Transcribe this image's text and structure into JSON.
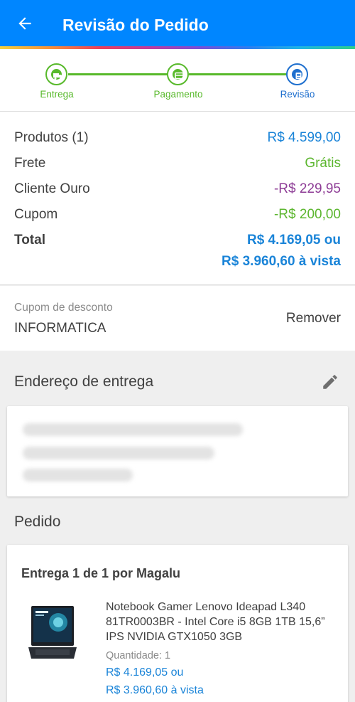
{
  "colors": {
    "header": "#0086ff",
    "accent_blue": "#1a84d8",
    "success_green": "#5cb62f",
    "discount_purple": "#8e3d96"
  },
  "header": {
    "title": "Revisão do Pedido",
    "back_icon": "arrow-left-icon"
  },
  "stepper": {
    "steps": [
      {
        "label": "Entrega",
        "icon": "truck-icon",
        "state": "done"
      },
      {
        "label": "Pagamento",
        "icon": "card-icon",
        "state": "done"
      },
      {
        "label": "Revisão",
        "icon": "list-icon",
        "state": "active"
      }
    ]
  },
  "summary": {
    "products_label": "Produtos (1)",
    "products_value": "R$ 4.599,00",
    "shipping_label": "Frete",
    "shipping_value": "Grátis",
    "gold_label": "Cliente Ouro",
    "gold_value": "-R$ 229,95",
    "coupon_label": "Cupom",
    "coupon_value": "-R$ 200,00",
    "total_label": "Total",
    "total_value": "R$ 4.169,05 ou",
    "total_cash": "R$ 3.960,60 à vista"
  },
  "coupon": {
    "caption": "Cupom de desconto",
    "code": "INFORMATICA",
    "remove_label": "Remover"
  },
  "address": {
    "title": "Endereço de entrega",
    "edit_icon": "pencil-icon"
  },
  "order": {
    "title": "Pedido",
    "delivery_label": "Entrega 1 de 1 por Magalu",
    "product_name": "Notebook Gamer Lenovo Ideapad L340 81TR0003BR - Intel Core i5 8GB 1TB 15,6” IPS NVIDIA GTX1050 3GB",
    "quantity_label": "Quantidade:  1",
    "price": "R$ 4.169,05 ou",
    "price_cash": "R$ 3.960,60 à vista"
  }
}
